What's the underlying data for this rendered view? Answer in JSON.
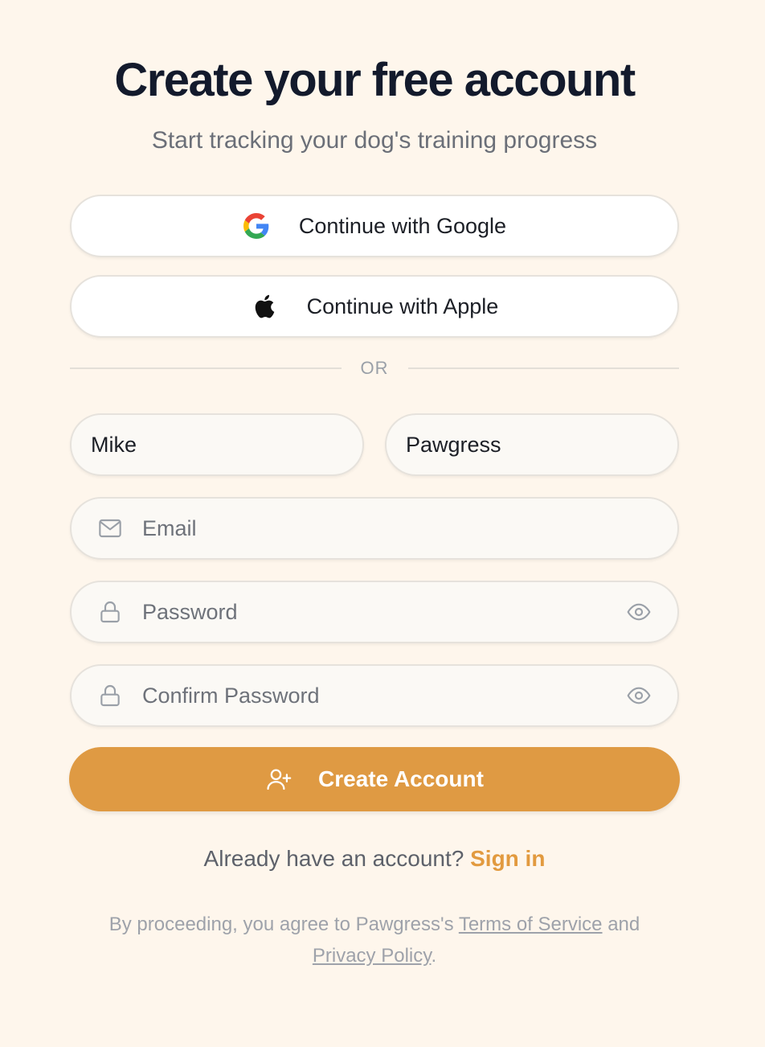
{
  "header": {
    "title": "Create your free account",
    "subtitle": "Start tracking your dog's training progress"
  },
  "social": {
    "google_label": "Continue with Google",
    "apple_label": "Continue with Apple"
  },
  "divider": {
    "text": "OR"
  },
  "form": {
    "first_name_value": "Mike",
    "last_name_value": "Pawgress",
    "email_placeholder": "Email",
    "password_placeholder": "Password",
    "confirm_password_placeholder": "Confirm Password",
    "submit_label": "Create Account"
  },
  "signin": {
    "prompt": "Already have an account?",
    "link": "Sign in"
  },
  "legal": {
    "prefix": "By proceeding, you agree to Pawgress's",
    "terms_link": "Terms of Service",
    "joiner": "and",
    "privacy_link": "Privacy Policy",
    "suffix": "."
  },
  "icons": {
    "google": "google-logo-icon",
    "apple": "apple-logo-icon",
    "email": "mail-icon",
    "lock": "lock-icon",
    "eye": "eye-icon",
    "add_user": "user-plus-icon"
  },
  "colors": {
    "background": "#fef6ec",
    "accent": "#df9a43",
    "link": "#e29a3f",
    "title": "#131a2c"
  }
}
